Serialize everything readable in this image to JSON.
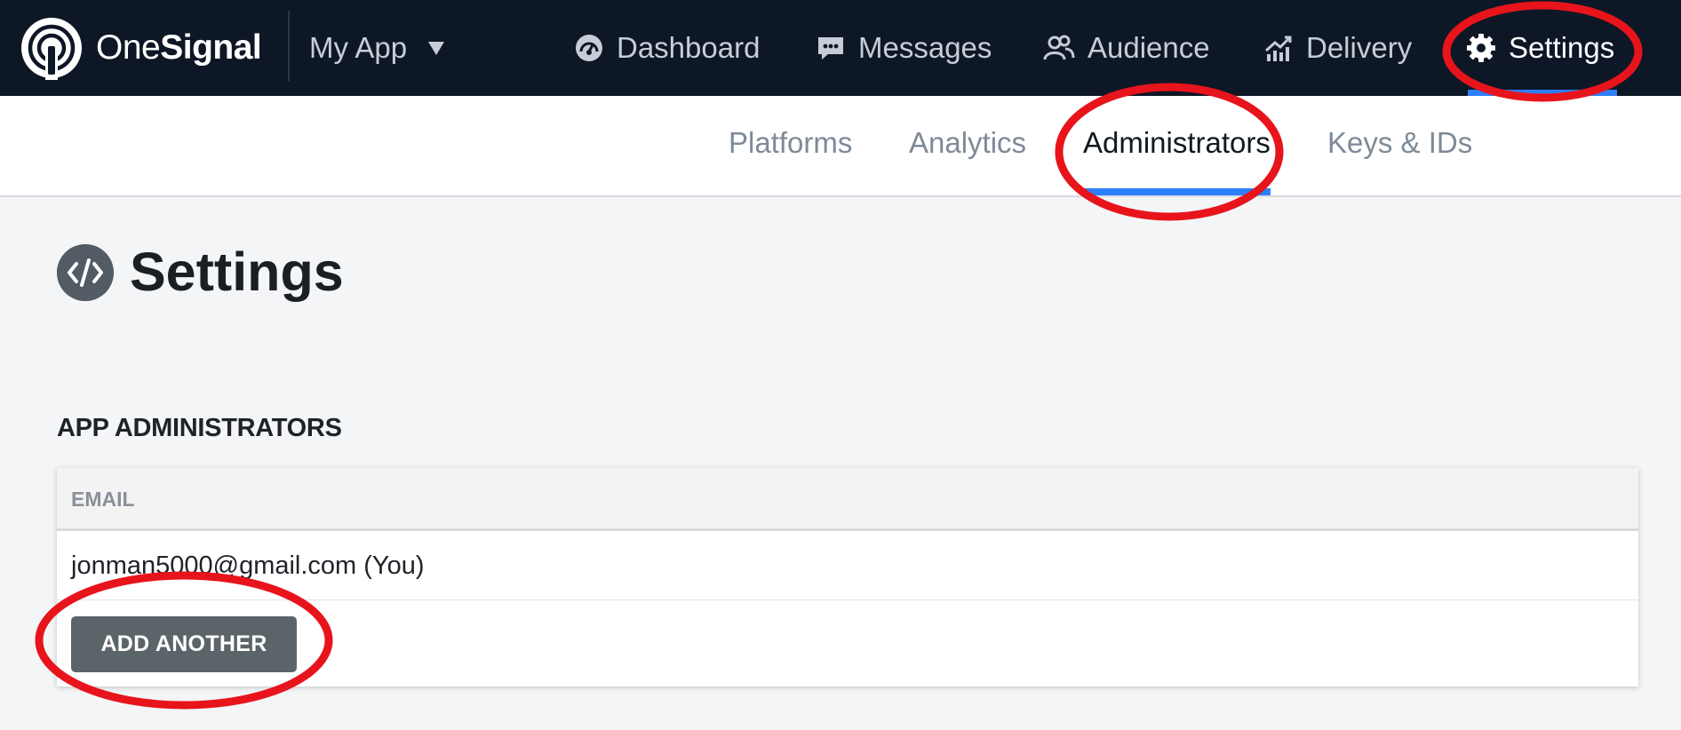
{
  "brand": {
    "part1": "One",
    "part2": "Signal"
  },
  "app_selector": {
    "label": "My App"
  },
  "nav": {
    "dashboard": "Dashboard",
    "messages": "Messages",
    "audience": "Audience",
    "delivery": "Delivery",
    "settings": "Settings"
  },
  "subtabs": {
    "platforms": "Platforms",
    "analytics": "Analytics",
    "administrators": "Administrators",
    "keys": "Keys & IDs"
  },
  "page": {
    "title": "Settings"
  },
  "admins": {
    "section_title": "APP ADMINISTRATORS",
    "column_header": "EMAIL",
    "rows": [
      "jonman5000@gmail.com (You)"
    ],
    "add_button": "ADD ANOTHER"
  },
  "colors": {
    "nav_bg": "#0e1726",
    "accent_blue": "#2d7ff9",
    "annotation_red": "#e8141b",
    "button_bg": "#5b6569"
  }
}
